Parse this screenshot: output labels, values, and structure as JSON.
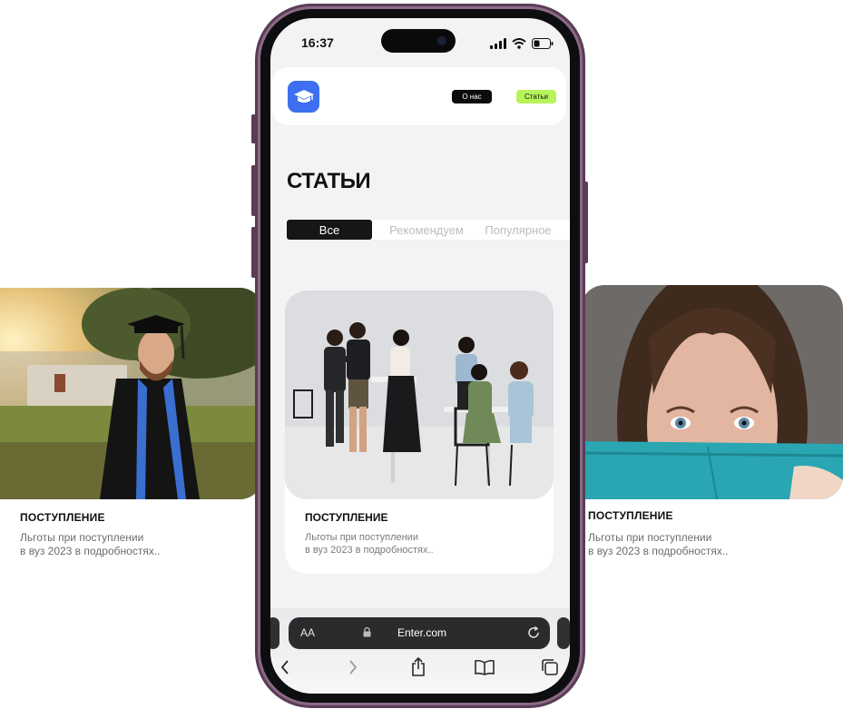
{
  "side_left": {
    "title": "ПОСТУПЛЕНИЕ",
    "desc_line1": "Льготы при поступлении",
    "desc_line2": "в вуз 2023 в подробностях.."
  },
  "side_right": {
    "title": "ПОСТУПЛЕНИЕ",
    "desc_line1": "Льготы при поступлении",
    "desc_line2": "в вуз 2023 в подробностях.."
  },
  "status_bar": {
    "time": "16:37"
  },
  "site_header": {
    "logo_icon": "graduation-cap-icon",
    "nav_about": "О нас",
    "nav_articles": "Статьи"
  },
  "page": {
    "title": "СТАТЬИ"
  },
  "tabs": [
    {
      "label": "Все",
      "active": true
    },
    {
      "label": "Рекомендуем",
      "active": false
    },
    {
      "label": "Популярное",
      "active": false
    }
  ],
  "card": {
    "title": "ПОСТУПЛЕНИЕ",
    "desc_line1": "Льготы при поступлении",
    "desc_line2": "в вуз 2023 в подробностях.."
  },
  "browser": {
    "text_size_label": "AA",
    "url": "Enter.com"
  },
  "colors": {
    "accent_blue": "#3d6ff0",
    "accent_green": "#b6f45a",
    "phone_frame": "#5a3c56"
  }
}
